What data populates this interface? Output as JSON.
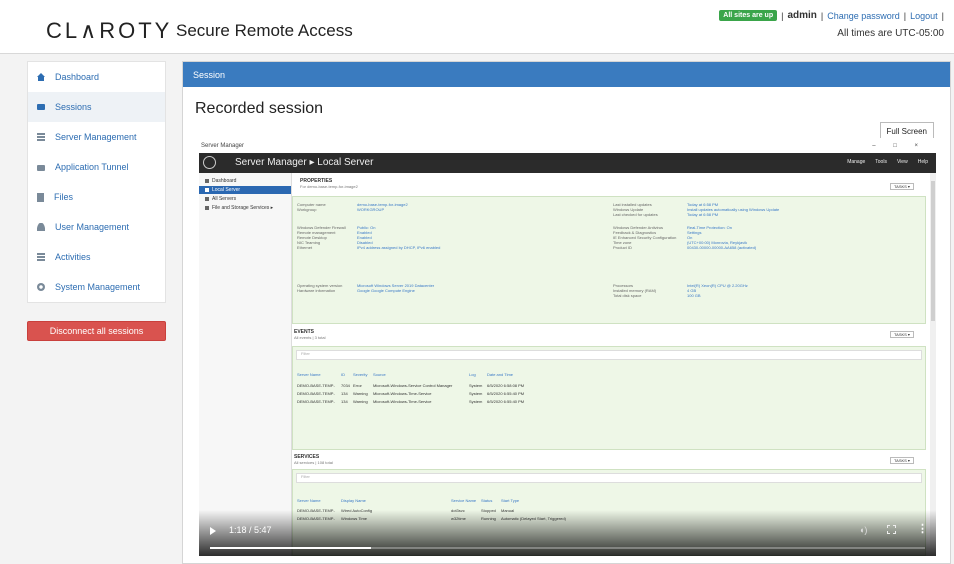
{
  "header": {
    "logo": "CL∧ROTY",
    "app_title": "Secure Remote Access",
    "status_badge": "All sites are up",
    "user": "admin",
    "change_password": "Change password",
    "logout": "Logout",
    "timezone_note": "All times are UTC-05:00"
  },
  "sidebar": {
    "items": [
      {
        "label": "Dashboard",
        "icon": "home-icon"
      },
      {
        "label": "Sessions",
        "icon": "video-camera-icon"
      },
      {
        "label": "Server Management",
        "icon": "server-icon"
      },
      {
        "label": "Application Tunnel",
        "icon": "lock-icon"
      },
      {
        "label": "Files",
        "icon": "file-icon"
      },
      {
        "label": "User Management",
        "icon": "user-icon"
      },
      {
        "label": "Activities",
        "icon": "list-icon"
      },
      {
        "label": "System Management",
        "icon": "gear-icon"
      }
    ],
    "disconnect_label": "Disconnect all sessions"
  },
  "main": {
    "panel_title": "Session",
    "page_title": "Recorded session",
    "fullscreen_label": "Full Screen"
  },
  "remote": {
    "window_title": "Server Manager",
    "window_controls": "– □ ×",
    "breadcrumb": "Server Manager ▸ Local Server",
    "menu": [
      "Manage",
      "Tools",
      "View",
      "Help"
    ],
    "nav": [
      "Dashboard",
      "Local Server",
      "All Servers",
      "File and Storage Services ▸"
    ],
    "properties": {
      "title": "PROPERTIES",
      "subtitle": "For demo-base-temp-for-image2",
      "tasks": "TASKS ▾",
      "left": [
        {
          "k": "Computer name",
          "v": "demo-base-temp-for-image2"
        },
        {
          "k": "Workgroup",
          "v": "WORKGROUP"
        },
        {
          "k": "Windows Defender Firewall",
          "v": "Public: On"
        },
        {
          "k": "Remote management",
          "v": "Enabled"
        },
        {
          "k": "Remote Desktop",
          "v": "Enabled"
        },
        {
          "k": "NIC Teaming",
          "v": "Disabled"
        },
        {
          "k": "Ethernet",
          "v": "IPv4 address assigned by DHCP, IPv6 enabled"
        },
        {
          "k": "Operating system version",
          "v": "Microsoft Windows Server 2019 Datacenter"
        },
        {
          "k": "Hardware information",
          "v": "Google Google Compute Engine"
        }
      ],
      "right": [
        {
          "k": "Last installed updates",
          "v": "Today at 6:58 PM"
        },
        {
          "k": "Windows Update",
          "v": "Install updates automatically using Windows Update"
        },
        {
          "k": "Last checked for updates",
          "v": "Today at 6:58 PM"
        },
        {
          "k": "Windows Defender Antivirus",
          "v": "Real-Time Protection: On"
        },
        {
          "k": "Feedback & Diagnostics",
          "v": "Settings"
        },
        {
          "k": "IE Enhanced Security Configuration",
          "v": "On"
        },
        {
          "k": "Time zone",
          "v": "(UTC+00:00) Monrovia, Reykjavik"
        },
        {
          "k": "Product ID",
          "v": "00430-00000-00000-AA658 (activated)"
        },
        {
          "k": "Processors",
          "v": "Intel(R) Xeon(R) CPU @ 2.20GHz"
        },
        {
          "k": "Installed memory (RAM)",
          "v": "4 GB"
        },
        {
          "k": "Total disk space",
          "v": "100 GB"
        }
      ]
    },
    "events": {
      "title": "EVENTS",
      "subtitle": "All events | 3 total",
      "filter_placeholder": "Filter",
      "tasks": "TASKS ▾",
      "columns": [
        "Server Name",
        "ID",
        "Severity",
        "Source",
        "Log",
        "Date and Time"
      ],
      "rows": [
        [
          "DEMO-BASE-TEMP-",
          "7034",
          "Error",
          "Microsoft-Windows-Service Control Manager",
          "System",
          "6/5/2020 6:58:08 PM"
        ],
        [
          "DEMO-BASE-TEMP-",
          "134",
          "Warning",
          "Microsoft-Windows-Time-Service",
          "System",
          "6/5/2020 6:55:40 PM"
        ],
        [
          "DEMO-BASE-TEMP-",
          "134",
          "Warning",
          "Microsoft-Windows-Time-Service",
          "System",
          "6/5/2020 6:55:40 PM"
        ]
      ]
    },
    "services": {
      "title": "SERVICES",
      "subtitle": "All services | 108 total",
      "filter_placeholder": "Filter",
      "tasks": "TASKS ▾",
      "columns": [
        "Server Name",
        "Display Name",
        "Service Name",
        "Status",
        "Start Type"
      ],
      "rows": [
        [
          "DEMO-BASE-TEMP-",
          "Wired AutoConfig",
          "dot3svc",
          "Stopped",
          "Manual"
        ],
        [
          "DEMO-BASE-TEMP-",
          "Windows Time",
          "w32time",
          "Running",
          "Automatic (Delayed Start, Triggered)"
        ]
      ]
    }
  },
  "player": {
    "time": "1:18 / 5:47",
    "progress": 0.225
  }
}
